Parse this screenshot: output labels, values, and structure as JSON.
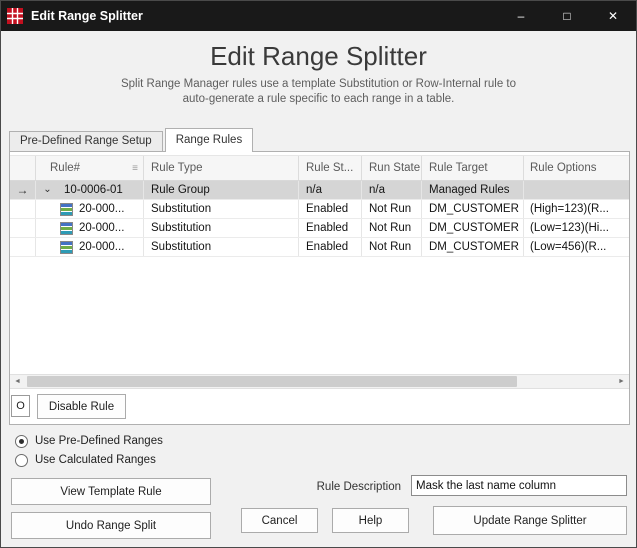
{
  "window": {
    "title": "Edit Range Splitter",
    "minimize": "–",
    "maximize": "□",
    "close": "✕"
  },
  "header": {
    "title": "Edit Range Splitter",
    "subtitle1": "Split Range Manager rules use a template Substitution or Row-Internal rule to",
    "subtitle2": "auto-generate a rule specific to each range in a table."
  },
  "tabs": {
    "predefined": "Pre-Defined Range Setup",
    "range_rules": "Range Rules"
  },
  "icons": {
    "sort": "≡",
    "expander": "⌄",
    "row_arrow": "→",
    "scroll_left": "◄",
    "scroll_right": "►"
  },
  "grid": {
    "columns": {
      "rule_no": "Rule#",
      "rule_type": "Rule Type",
      "rule_status": "Rule St...",
      "run_state": "Run State",
      "rule_target": "Rule Target",
      "rule_options": "Rule Options"
    },
    "rows": [
      {
        "rule_no": "10-0006-01",
        "rule_type": "Rule Group",
        "rule_status": "n/a",
        "run_state": "n/a",
        "rule_target": "Managed Rules",
        "rule_options": ""
      },
      {
        "rule_no": "20-000...",
        "rule_type": "Substitution",
        "rule_status": "Enabled",
        "run_state": "Not Run",
        "rule_target": "DM_CUSTOMER",
        "rule_options": "(High=123)(R..."
      },
      {
        "rule_no": "20-000...",
        "rule_type": "Substitution",
        "rule_status": "Enabled",
        "run_state": "Not Run",
        "rule_target": "DM_CUSTOMER",
        "rule_options": "(Low=123)(Hi..."
      },
      {
        "rule_no": "20-000...",
        "rule_type": "Substitution",
        "rule_status": "Enabled",
        "run_state": "Not Run",
        "rule_target": "DM_CUSTOMER",
        "rule_options": "(Low=456)(R..."
      }
    ]
  },
  "controls": {
    "status_cell": "O",
    "disable_rule": "Disable Rule",
    "radio_predefined": "Use Pre-Defined Ranges",
    "radio_calculated": "Use Calculated Ranges",
    "view_template": "View Template Rule",
    "undo_split": "Undo Range Split",
    "rule_description_label": "Rule Description",
    "rule_description_value": "Mask the last name column",
    "cancel": "Cancel",
    "help": "Help",
    "update": "Update Range Splitter"
  },
  "colors": {
    "accent_red": "#c3101f",
    "titlebar": "#191919",
    "selected_row": "#d5d5d5"
  }
}
